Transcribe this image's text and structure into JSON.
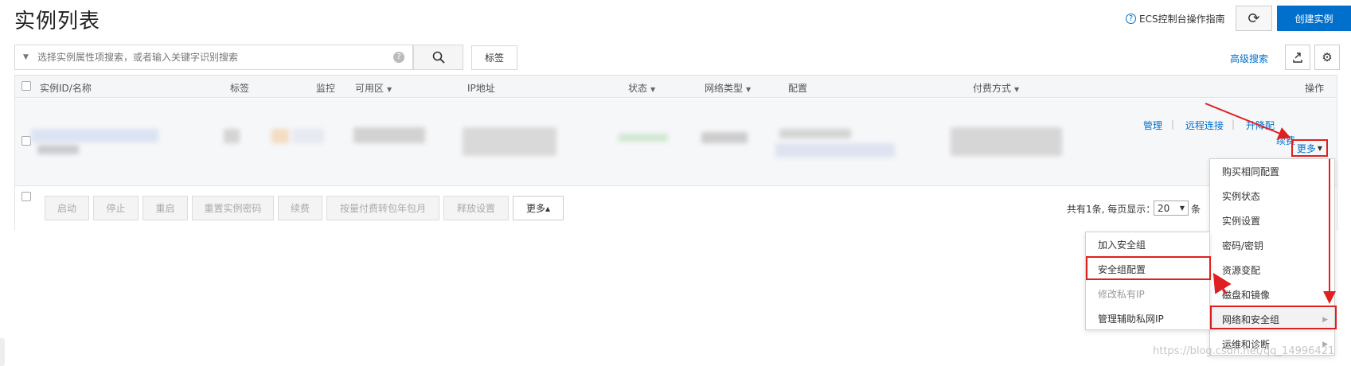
{
  "page": {
    "title": "实例列表",
    "guide_link": "ECS控制台操作指南",
    "create_button": "创建实例"
  },
  "search": {
    "placeholder": "选择实例属性项搜索，或者输入关键字识别搜索",
    "tag_button": "标签",
    "advanced_search": "高级搜索"
  },
  "table": {
    "headers": {
      "id_name": "实例ID/名称",
      "tags": "标签",
      "monitor": "监控",
      "zone": "可用区",
      "ip": "IP地址",
      "status": "状态",
      "network": "网络类型",
      "config": "配置",
      "billing": "付费方式",
      "actions": "操作"
    },
    "row_actions": {
      "manage": "管理",
      "remote": "远程连接",
      "upgrade": "升降配",
      "renew": "续费",
      "more": "更多"
    }
  },
  "bottom_actions": {
    "start": "启动",
    "stop": "停止",
    "restart": "重启",
    "reset_password": "重置实例密码",
    "renew": "续费",
    "convert": "按量付费转包年包月",
    "release": "释放设置",
    "more": "更多▴"
  },
  "pager": {
    "summary": "共有1条, 每页显示：",
    "page_size": "20",
    "unit": "条"
  },
  "more_menu": {
    "items": [
      {
        "label": "购买相同配置"
      },
      {
        "label": "实例状态"
      },
      {
        "label": "实例设置"
      },
      {
        "label": "密码/密钥"
      },
      {
        "label": "资源变配"
      },
      {
        "label": "磁盘和镜像"
      },
      {
        "label": "网络和安全组"
      },
      {
        "label": "运维和诊断"
      }
    ]
  },
  "submenu": {
    "items": [
      {
        "label": "加入安全组"
      },
      {
        "label": "安全组配置"
      },
      {
        "label": "修改私有IP"
      },
      {
        "label": "管理辅助私网IP"
      }
    ]
  },
  "watermark": "https://blog.csdn.net/qq_14996421",
  "colors": {
    "accent": "#0070cc",
    "highlight": "#e02020"
  }
}
